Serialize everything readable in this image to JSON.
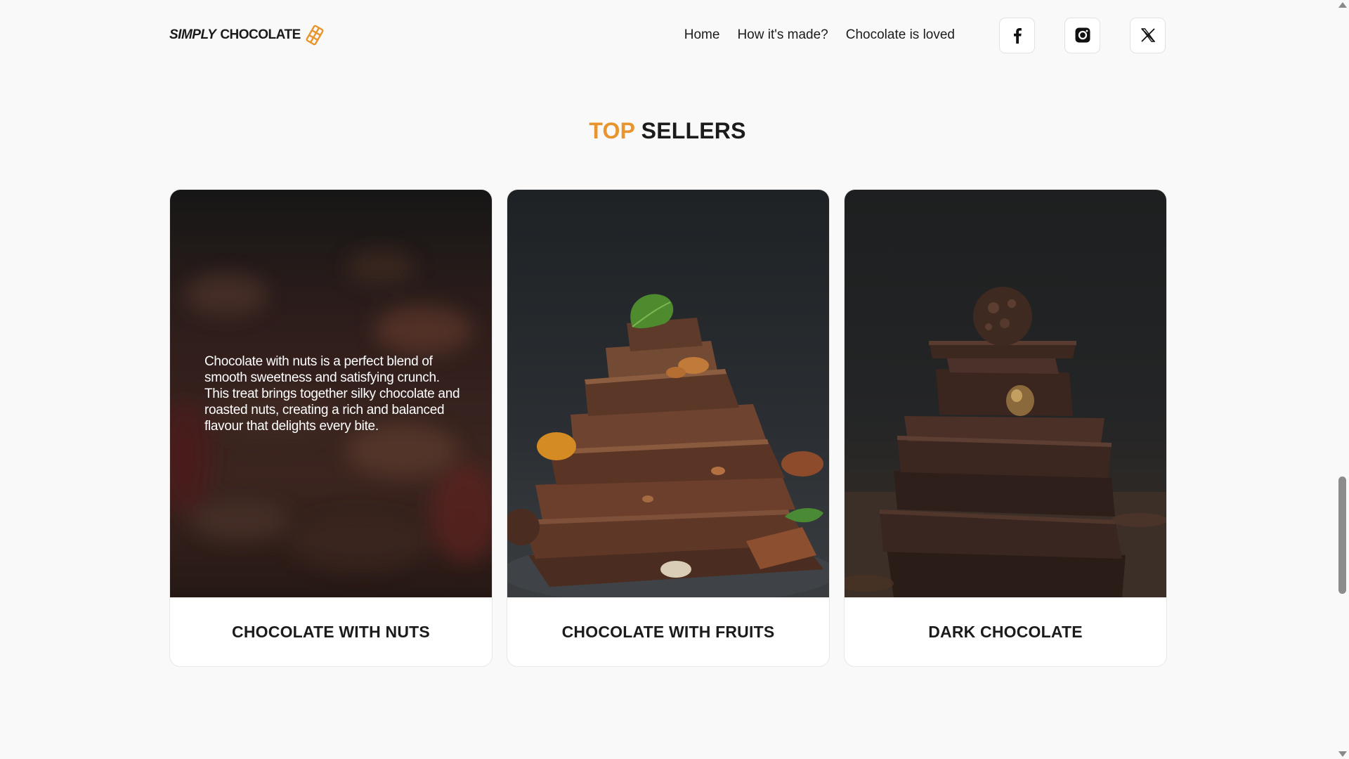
{
  "brand": {
    "simply": "SIMPLY",
    "chocolate": "CHOCOLATE",
    "accent_color": "#e8952e"
  },
  "nav": {
    "items": [
      {
        "label": "Home"
      },
      {
        "label": "How it's made?"
      },
      {
        "label": "Chocolate is loved"
      }
    ]
  },
  "socials": [
    {
      "icon": "facebook-icon"
    },
    {
      "icon": "instagram-icon"
    },
    {
      "icon": "x-icon"
    }
  ],
  "section": {
    "title_accent": "TOP",
    "title_rest": "SELLERS"
  },
  "cards": [
    {
      "title": "CHOCOLATE WITH NUTS",
      "description": "Chocolate with nuts is a perfect blend of smooth sweetness and satisfying crunch. This treat brings together silky chocolate and roasted nuts, creating a rich and balanced flavour that delights every bite."
    },
    {
      "title": "CHOCOLATE WITH FRUITS"
    },
    {
      "title": "DARK CHOCOLATE"
    }
  ]
}
